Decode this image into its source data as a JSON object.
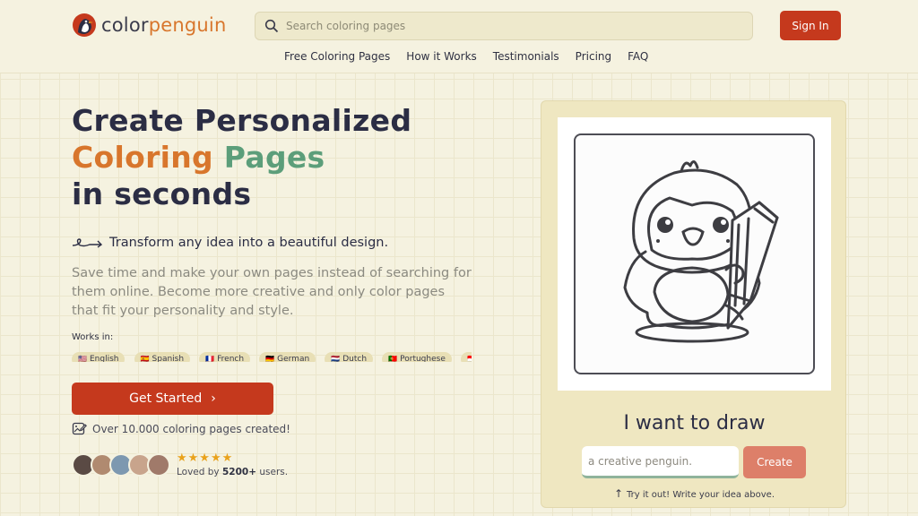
{
  "brand": {
    "name_part1": "color",
    "name_part2": "penguin"
  },
  "search": {
    "placeholder": "Search coloring pages"
  },
  "header": {
    "signin_label": "Sign In"
  },
  "nav": {
    "items": [
      {
        "label": "Free Coloring Pages"
      },
      {
        "label": "How it Works"
      },
      {
        "label": "Testimonials"
      },
      {
        "label": "Pricing"
      },
      {
        "label": "FAQ"
      }
    ]
  },
  "hero": {
    "title_line1": "Create Personalized",
    "title_line2_a": "Coloring",
    "title_line2_b": " Pages",
    "title_line3": "in seconds",
    "tagline": "Transform any idea into a beautiful design.",
    "description": "Save time and make your own pages instead of searching for them online. Become more creative and only color pages that fit your personality and style.",
    "works_in_label": "Works in:",
    "languages": [
      {
        "flag": "🇺🇸",
        "name": "English"
      },
      {
        "flag": "🇪🇸",
        "name": "Spanish"
      },
      {
        "flag": "🇫🇷",
        "name": "French"
      },
      {
        "flag": "🇩🇪",
        "name": "German"
      },
      {
        "flag": "🇳🇱",
        "name": "Dutch"
      },
      {
        "flag": "🇵🇹",
        "name": "Portughese"
      },
      {
        "flag": "🇮🇩",
        "name": ""
      }
    ],
    "cta_label": "Get Started",
    "pages_created": "Over 10.000 coloring pages created!",
    "stars": "★★★★★",
    "loved_prefix": "Loved by ",
    "loved_count": "5200+",
    "loved_suffix": " users.",
    "avatar_colors": [
      "#5a4a44",
      "#b08a70",
      "#7d98b0",
      "#c8a48c",
      "#a07a6a"
    ]
  },
  "generator": {
    "heading": "I want to draw",
    "input_placeholder": "a creative penguin.",
    "create_label": "Create",
    "hint": "Try it out! Write your idea above."
  },
  "colors": {
    "accent_red": "#c5391d",
    "create_button": "#dd7f69",
    "background": "#f5f2e0",
    "coloring_orange": "#d8762c",
    "pages_green": "#5c9e7a"
  }
}
